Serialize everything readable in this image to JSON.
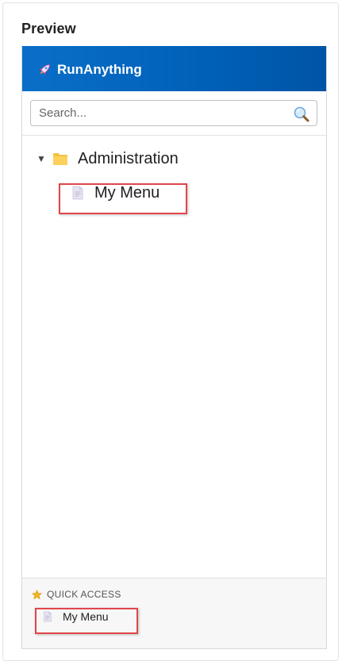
{
  "page": {
    "heading": "Preview"
  },
  "app": {
    "title": "RunAnything",
    "brand_color": "#0064c0"
  },
  "search": {
    "placeholder": "Search...",
    "value": ""
  },
  "tree": {
    "folder": {
      "label": "Administration",
      "expanded": true,
      "icon": "folder-icon"
    },
    "items": [
      {
        "label": "My Menu",
        "icon": "document-icon",
        "highlighted": true
      }
    ]
  },
  "quick_access": {
    "title": "QUICK ACCESS",
    "icon": "star-icon",
    "items": [
      {
        "label": "My Menu",
        "icon": "document-icon",
        "highlighted": true
      }
    ]
  },
  "colors": {
    "highlight": "#e0474a",
    "folder": "#f5c242",
    "star": "#f0b429"
  }
}
